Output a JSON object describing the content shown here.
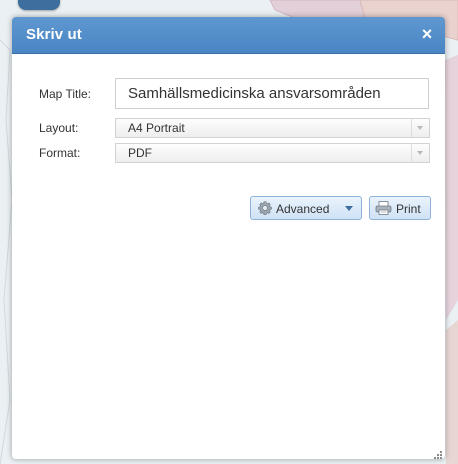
{
  "dialog": {
    "title": "Skriv ut",
    "close_symbol": "×"
  },
  "form": {
    "map_title": {
      "label": "Map Title:",
      "value": "Samhällsmedicinska ansvarsområden"
    },
    "layout": {
      "label": "Layout:",
      "selected": "A4 Portrait"
    },
    "format": {
      "label": "Format:",
      "selected": "PDF"
    }
  },
  "buttons": {
    "advanced": {
      "label": "Advanced",
      "icon": "gear-icon"
    },
    "print": {
      "label": "Print",
      "icon": "printer-icon"
    }
  },
  "colors": {
    "header": "#4a86c4",
    "button_border": "#8fb4d8",
    "map_water": "#eaf0f3"
  }
}
